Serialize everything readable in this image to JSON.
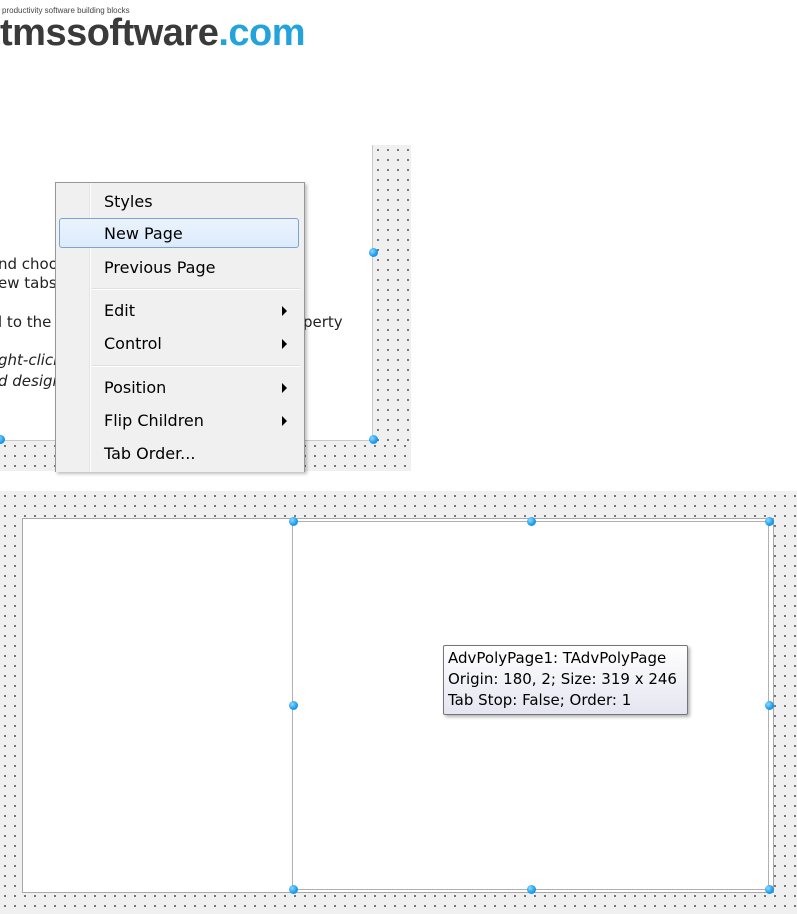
{
  "logo": {
    "tagline": "productivity software building blocks",
    "name_main": "tmssoftware",
    "name_domain": ".com"
  },
  "background_text": {
    "line1": "nd choos",
    "line2": "ew tabsh",
    "line3": "l to the t",
    "line3_right": "perty",
    "line4": "ght-click",
    "line5": "d design"
  },
  "context_menu": {
    "items": [
      {
        "label": "Styles",
        "submenu": false
      },
      {
        "label": "New Page",
        "submenu": false,
        "highlighted": true
      },
      {
        "label": "Previous Page",
        "submenu": false
      },
      {
        "label": "Edit",
        "submenu": true
      },
      {
        "label": "Control",
        "submenu": true
      },
      {
        "label": "Position",
        "submenu": true
      },
      {
        "label": "Flip Children",
        "submenu": true
      },
      {
        "label": "Tab Order...",
        "submenu": false
      }
    ]
  },
  "tooltip": {
    "line1": "AdvPolyPage1: TAdvPolyPage",
    "line2": "Origin: 180, 2; Size: 319 x 246",
    "line3": "Tab Stop: False; Order: 1"
  },
  "colors": {
    "logo_text": "#3a3a3a",
    "logo_accent": "#22a3dc",
    "handle": "#1e9ef0",
    "highlight_border": "#7da2ce"
  }
}
